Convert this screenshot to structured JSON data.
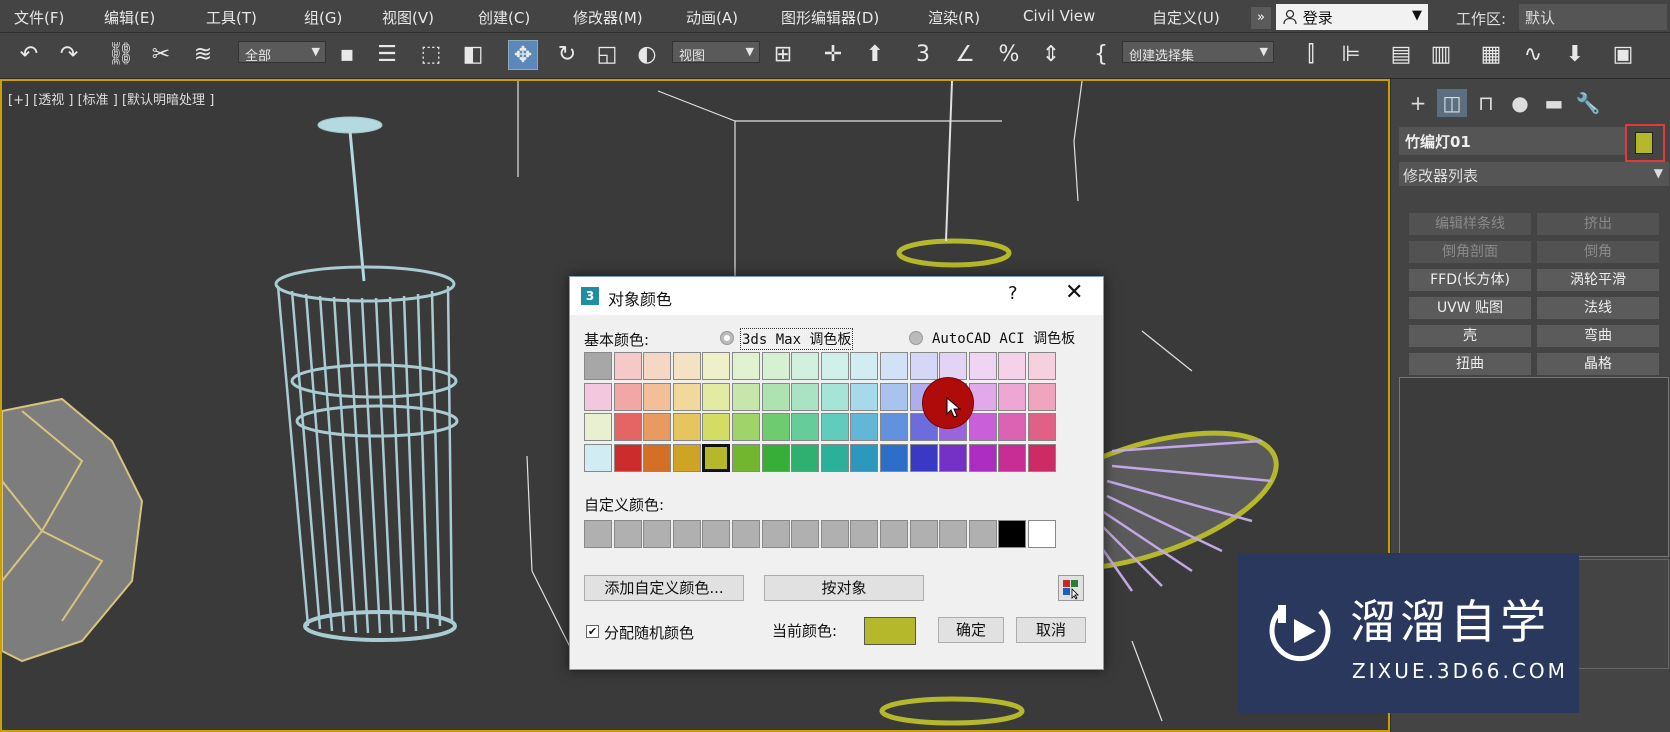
{
  "menu": [
    "文件(F)",
    "编辑(E)",
    "工具(T)",
    "组(G)",
    "视图(V)",
    "创建(C)",
    "修改器(M)",
    "动画(A)",
    "图形编辑器(D)",
    "渲染(R)",
    "Civil View",
    "自定义(U)"
  ],
  "menu_overflow": "»",
  "login": {
    "label": "登录",
    "icon": "user-icon"
  },
  "workspace": {
    "label": "工作区:",
    "value": "默认"
  },
  "toolbar": {
    "selection_filter": "全部",
    "coord_system": "视图",
    "named_selection": "创建选择集",
    "icons": [
      "undo-icon",
      "redo-icon",
      "link-icon",
      "unlink-icon",
      "bind-spacewarp-icon",
      "select-object-icon",
      "select-by-name-icon",
      "rect-region-icon",
      "window-crossing-icon",
      "move-icon",
      "rotate-icon",
      "scale-icon",
      "placement-icon",
      "pivot-icon",
      "snap-icon",
      "mirror-icon",
      "align-icon",
      "layer-icon",
      "scene-explorer-icon",
      "material-editor-icon",
      "render-setup-icon",
      "render-frame-icon"
    ]
  },
  "viewport": {
    "label": "[+] [透视 ] [标准 ] [默认明暗处理 ]"
  },
  "command_panel": {
    "tabs": [
      "create-tab",
      "modify-tab",
      "hierarchy-tab",
      "motion-tab",
      "display-tab",
      "utilities-tab"
    ],
    "object_name": "竹编灯01",
    "object_color": "#b5b82a",
    "modifier_list": "修改器列表",
    "modifier_buttons": [
      {
        "label": "编辑样条线",
        "enabled": false
      },
      {
        "label": "挤出",
        "enabled": false
      },
      {
        "label": "倒角剖面",
        "enabled": false
      },
      {
        "label": "倒角",
        "enabled": false
      },
      {
        "label": "FFD(长方体)",
        "enabled": true
      },
      {
        "label": "涡轮平滑",
        "enabled": true
      },
      {
        "label": "UVW 贴图",
        "enabled": true
      },
      {
        "label": "法线",
        "enabled": true
      },
      {
        "label": "壳",
        "enabled": true
      },
      {
        "label": "弯曲",
        "enabled": true
      },
      {
        "label": "扭曲",
        "enabled": true
      },
      {
        "label": "晶格",
        "enabled": true
      }
    ]
  },
  "dialog": {
    "title": "对象颜色",
    "help": "?",
    "close": "✕",
    "basic_colors_label": "基本颜色:",
    "radio_max": "3ds Max 调色板",
    "radio_aci": "AutoCAD ACI 调色板",
    "palette_selected": "3ds Max 调色板",
    "basic_colors": [
      [
        "#a7a7a7",
        "#f6c9c9",
        "#f5d8c4",
        "#f3e3c4",
        "#eef0c7",
        "#e0f2cf",
        "#d6f0d2",
        "#d2f0de",
        "#d0f1ea",
        "#d1ecf3",
        "#d2e1f5",
        "#d6d6f6",
        "#e3d3f5",
        "#efd4f4",
        "#f4d2ea",
        "#f5d0de"
      ],
      [
        "#f3c7dd",
        "#f2a7a7",
        "#f2bf99",
        "#f1d89b",
        "#e2eba1",
        "#c7e6ac",
        "#aee3b1",
        "#a9e3c4",
        "#a6e4d8",
        "#a6d9ea",
        "#a7c3ee",
        "#aeaeee",
        "#c8aaee",
        "#e1a9ec",
        "#eea7d5",
        "#f0a4bd"
      ],
      [
        "#e9f0d2",
        "#e46564",
        "#e89a60",
        "#e6c45e",
        "#d4dc63",
        "#9ed46a",
        "#6fcb70",
        "#66cc99",
        "#61ccbd",
        "#62b6d6",
        "#6292dd",
        "#6c6cdc",
        "#9b64dc",
        "#c960d9",
        "#dc62b3",
        "#e06086"
      ],
      [
        "#d2ecf3",
        "#cc2c2c",
        "#d46f26",
        "#cfa424",
        "#b5b82a",
        "#72b62f",
        "#36ae37",
        "#2fb070",
        "#2bb09c",
        "#2c98bd",
        "#2c6ec8",
        "#3939c5",
        "#7530c5",
        "#ad2cc1",
        "#c72d95",
        "#cc2c63"
      ]
    ],
    "selected_swatch": "#b5b82a",
    "custom_colors_label": "自定义颜色:",
    "custom_colors": [
      "#b0b0b0",
      "#b0b0b0",
      "#b0b0b0",
      "#b0b0b0",
      "#b0b0b0",
      "#b0b0b0",
      "#b0b0b0",
      "#b0b0b0",
      "#b0b0b0",
      "#b0b0b0",
      "#b0b0b0",
      "#b0b0b0",
      "#b0b0b0",
      "#b0b0b0",
      "#000000",
      "#ffffff"
    ],
    "add_custom_button": "添加自定义颜色...",
    "by_object_button": "按对象",
    "random_checkbox_label": "分配随机颜色",
    "random_checked": true,
    "current_color_label": "当前颜色:",
    "current_color": "#b5b82a",
    "ok_button": "确定",
    "cancel_button": "取消"
  },
  "watermark": {
    "title": "溜溜自学",
    "subtitle": "ZIXUE.3D66.COM"
  }
}
